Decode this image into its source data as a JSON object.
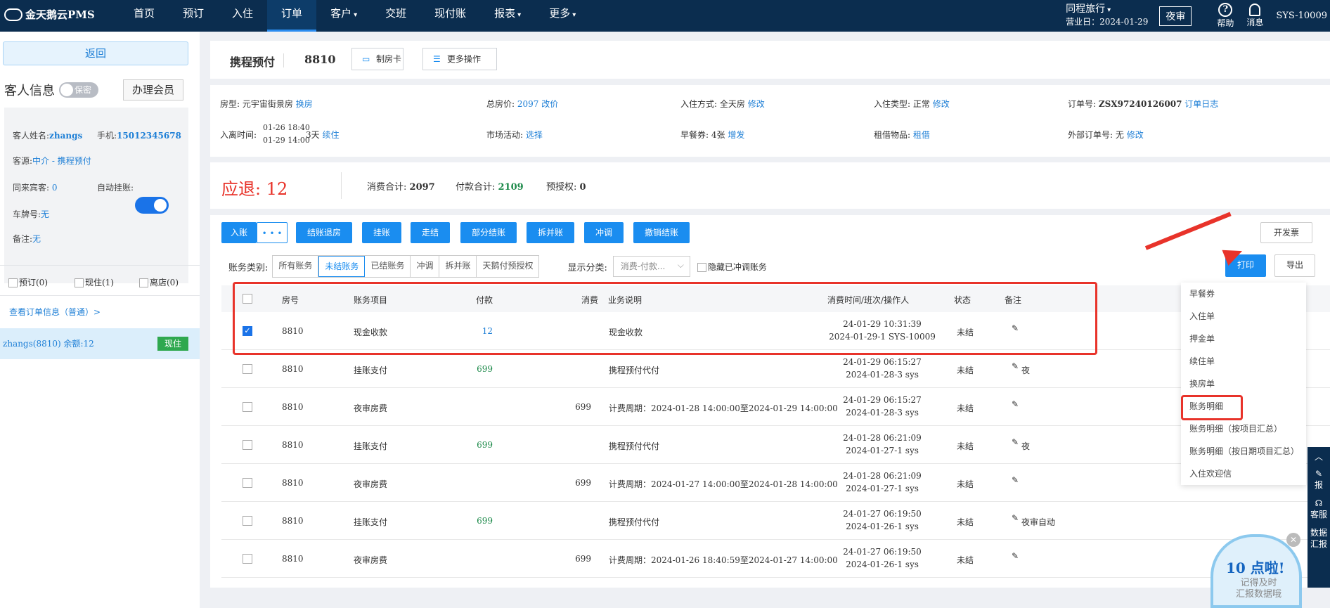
{
  "topbar": {
    "logo": "金天鹅云PMS",
    "nav": [
      {
        "label": "首页"
      },
      {
        "label": "预订"
      },
      {
        "label": "入住"
      },
      {
        "label": "订单"
      },
      {
        "label": "客户"
      },
      {
        "label": "交班"
      },
      {
        "label": "现付账"
      },
      {
        "label": "报表"
      },
      {
        "label": "更多"
      }
    ],
    "hotel": "同程旅行",
    "business_date": "营业日：2024-01-29",
    "night_audit": "夜审",
    "help": "帮助",
    "messages": "消息",
    "user": "SYS-10009"
  },
  "left": {
    "back": "返回",
    "guest_info": "客人信息",
    "privacy": "保密",
    "vip_button": "办理会员",
    "name_label": "客人姓名:",
    "name": "zhangs",
    "phone_label": "手机:",
    "phone": "15012345678",
    "source_label": "客源:",
    "source": "中介 - 携程预付",
    "companions_label": "同来宾客:",
    "companions": "0",
    "auto_charge_label": "自动挂账:",
    "plate_label": "车牌号:",
    "plate": "无",
    "remark_label": "备注:",
    "remark": "无",
    "reserved": "预订(0)",
    "checked_in": "现住(1)",
    "checked_out": "离店(0)",
    "order_link": "查看订单信息（普通）>",
    "guest_row": "zhangs(8810)   余额:12",
    "guest_status": "现住"
  },
  "header": {
    "title": "携程预付",
    "room": "8810",
    "room_card_btn": "制房卡",
    "more_btn": "更多操作"
  },
  "info": {
    "room_type_label": "房型:",
    "room_type": "元宇宙街景房",
    "room_type_action": "换房",
    "total_label": "总房价:",
    "total": "2097",
    "total_action": "改价",
    "checkin_mode_label": "入住方式:",
    "checkin_mode": "全天房",
    "checkin_mode_action": "修改",
    "checkin_type_label": "入住类型:",
    "checkin_type": "正常",
    "checkin_type_action": "修改",
    "order_no_label": "订单号:",
    "order_no": "ZSX97240126007",
    "order_log": "订单日志",
    "time_label": "入离时间:",
    "time_in": "01-26 18:40",
    "time_out": "01-29 14:00",
    "nights": "3天",
    "extend": "续住",
    "market_label": "市场活动:",
    "market_action": "选择",
    "breakfast_label": "早餐券:",
    "breakfast": "4张",
    "breakfast_action": "增发",
    "rental_label": "租借物品:",
    "rental_action": "租借",
    "ext_order_label": "外部订单号:",
    "ext_order": "无",
    "ext_order_action": "修改"
  },
  "summary": {
    "refund_label": "应退:",
    "refund": "12",
    "consume_label": "消费合计:",
    "consume": "2097",
    "pay_label": "付款合计:",
    "pay": "2109",
    "preauth_label": "预授权:",
    "preauth": "0"
  },
  "actions": {
    "post": "入账",
    "post_more": "• • •",
    "checkout": "结账退房",
    "hang": "挂账",
    "walk": "走结",
    "partial": "部分结账",
    "split": "拆并账",
    "reverse": "冲调",
    "cancel_checkout": "撤销结账",
    "invoice": "开发票",
    "print": "打印",
    "export": "导出"
  },
  "filters": {
    "category_label": "账务类别:",
    "categories": [
      "所有账务",
      "未结账务",
      "已结账务",
      "冲调",
      "拆并账",
      "天鹅付预授权"
    ],
    "display_label": "显示分类:",
    "display_value": "消费-付款...",
    "hide_reversed": "隐藏已冲调账务"
  },
  "table": {
    "headers": {
      "room": "房号",
      "item": "账务项目",
      "pay": "付款",
      "consume": "消费",
      "desc": "业务说明",
      "time": "消费时间/班次/操作人",
      "status": "状态",
      "remark": "备注"
    },
    "rows": [
      {
        "room": "8810",
        "item": "现金收款",
        "pay": "12",
        "consume": "",
        "desc": "现金收款",
        "t1": "24-01-29 10:31:39",
        "t2": "2024-01-29-1 SYS-10009",
        "status": "未结",
        "remark": ""
      },
      {
        "room": "8810",
        "item": "挂账支付",
        "pay": "699",
        "consume": "",
        "desc": "携程预付代付",
        "t1": "24-01-29 06:15:27",
        "t2": "2024-01-28-3 sys",
        "status": "未结",
        "remark": "夜"
      },
      {
        "room": "8810",
        "item": "夜审房费",
        "pay": "",
        "consume": "699",
        "desc": "计费周期：2024-01-28 14:00:00至2024-01-29 14:00:00",
        "t1": "24-01-29 06:15:27",
        "t2": "2024-01-28-3 sys",
        "status": "未结",
        "remark": ""
      },
      {
        "room": "8810",
        "item": "挂账支付",
        "pay": "699",
        "consume": "",
        "desc": "携程预付代付",
        "t1": "24-01-28 06:21:09",
        "t2": "2024-01-27-1 sys",
        "status": "未结",
        "remark": "夜"
      },
      {
        "room": "8810",
        "item": "夜审房费",
        "pay": "",
        "consume": "699",
        "desc": "计费周期：2024-01-27 14:00:00至2024-01-28 14:00:00",
        "t1": "24-01-28 06:21:09",
        "t2": "2024-01-27-1 sys",
        "status": "未结",
        "remark": ""
      },
      {
        "room": "8810",
        "item": "挂账支付",
        "pay": "699",
        "consume": "",
        "desc": "携程预付代付",
        "t1": "24-01-27 06:19:50",
        "t2": "2024-01-26-1 sys",
        "status": "未结",
        "remark": "夜审自动"
      },
      {
        "room": "8810",
        "item": "夜审房费",
        "pay": "",
        "consume": "699",
        "desc": "计费周期：2024-01-26 18:40:59至2024-01-27 14:00:00",
        "t1": "24-01-27 06:19:50",
        "t2": "2024-01-26-1 sys",
        "status": "未结",
        "remark": ""
      }
    ]
  },
  "print_menu": [
    "早餐券",
    "入住单",
    "押金单",
    "续住单",
    "换房单",
    "账务明细",
    "账务明细（按项目汇总）",
    "账务明细（按日期项目汇总）",
    "入住欢迎信"
  ],
  "side_tools": [
    "报",
    "客服",
    "数据汇报"
  ],
  "ad": {
    "title": "10 点啦!",
    "line1": "记得及时",
    "line2": "汇报数据哦"
  },
  "colors": {
    "topbar": "#0b2d4f",
    "primary": "#1a8df0",
    "refund": "#e8332a",
    "pay_green": "#1d8a4a"
  }
}
